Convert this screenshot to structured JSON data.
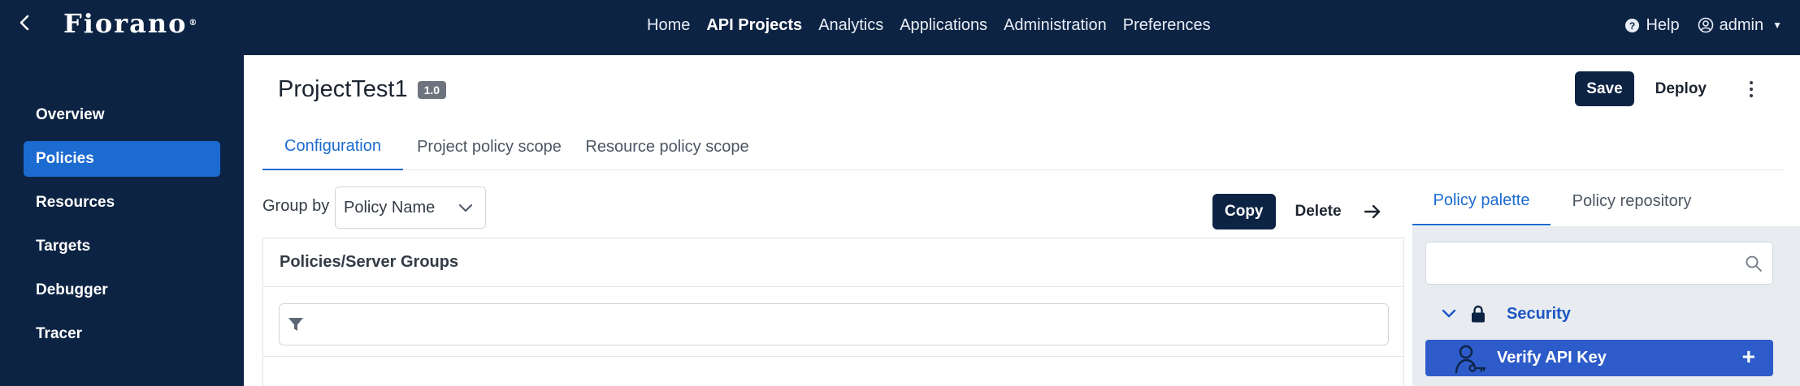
{
  "app": {
    "logo_text": "Fiorano",
    "logo_mark": "®"
  },
  "top_nav": {
    "items": [
      {
        "label": "Home",
        "active": false
      },
      {
        "label": "API Projects",
        "active": true
      },
      {
        "label": "Analytics",
        "active": false
      },
      {
        "label": "Applications",
        "active": false
      },
      {
        "label": "Administration",
        "active": false
      },
      {
        "label": "Preferences",
        "active": false
      }
    ],
    "help_label": "Help",
    "user_label": "admin"
  },
  "sidebar": {
    "items": [
      {
        "label": "Overview",
        "active": false
      },
      {
        "label": "Policies",
        "active": true
      },
      {
        "label": "Resources",
        "active": false
      },
      {
        "label": "Targets",
        "active": false
      },
      {
        "label": "Debugger",
        "active": false
      },
      {
        "label": "Tracer",
        "active": false
      }
    ]
  },
  "project": {
    "name": "ProjectTest1",
    "version": "1.0",
    "save_label": "Save",
    "deploy_label": "Deploy"
  },
  "tabs": [
    {
      "label": "Configuration",
      "active": true
    },
    {
      "label": "Project policy scope",
      "active": false
    },
    {
      "label": "Resource policy scope",
      "active": false
    }
  ],
  "toolbar": {
    "group_by_label": "Group by",
    "group_by_value": "Policy Name",
    "copy_label": "Copy",
    "delete_label": "Delete"
  },
  "policies_panel": {
    "header": "Policies/Server Groups",
    "filter_placeholder": ""
  },
  "palette": {
    "tabs": [
      {
        "label": "Policy palette",
        "active": true
      },
      {
        "label": "Policy repository",
        "active": false
      }
    ],
    "search_placeholder": "",
    "category": "Security",
    "policy_item": "Verify API Key",
    "add_symbol": "+"
  },
  "colors": {
    "nav_bg": "#0d2343",
    "accent": "#1c6bd0",
    "palette_item_bg": "#2d5bc9",
    "palette_bg": "#e8ecf0"
  }
}
